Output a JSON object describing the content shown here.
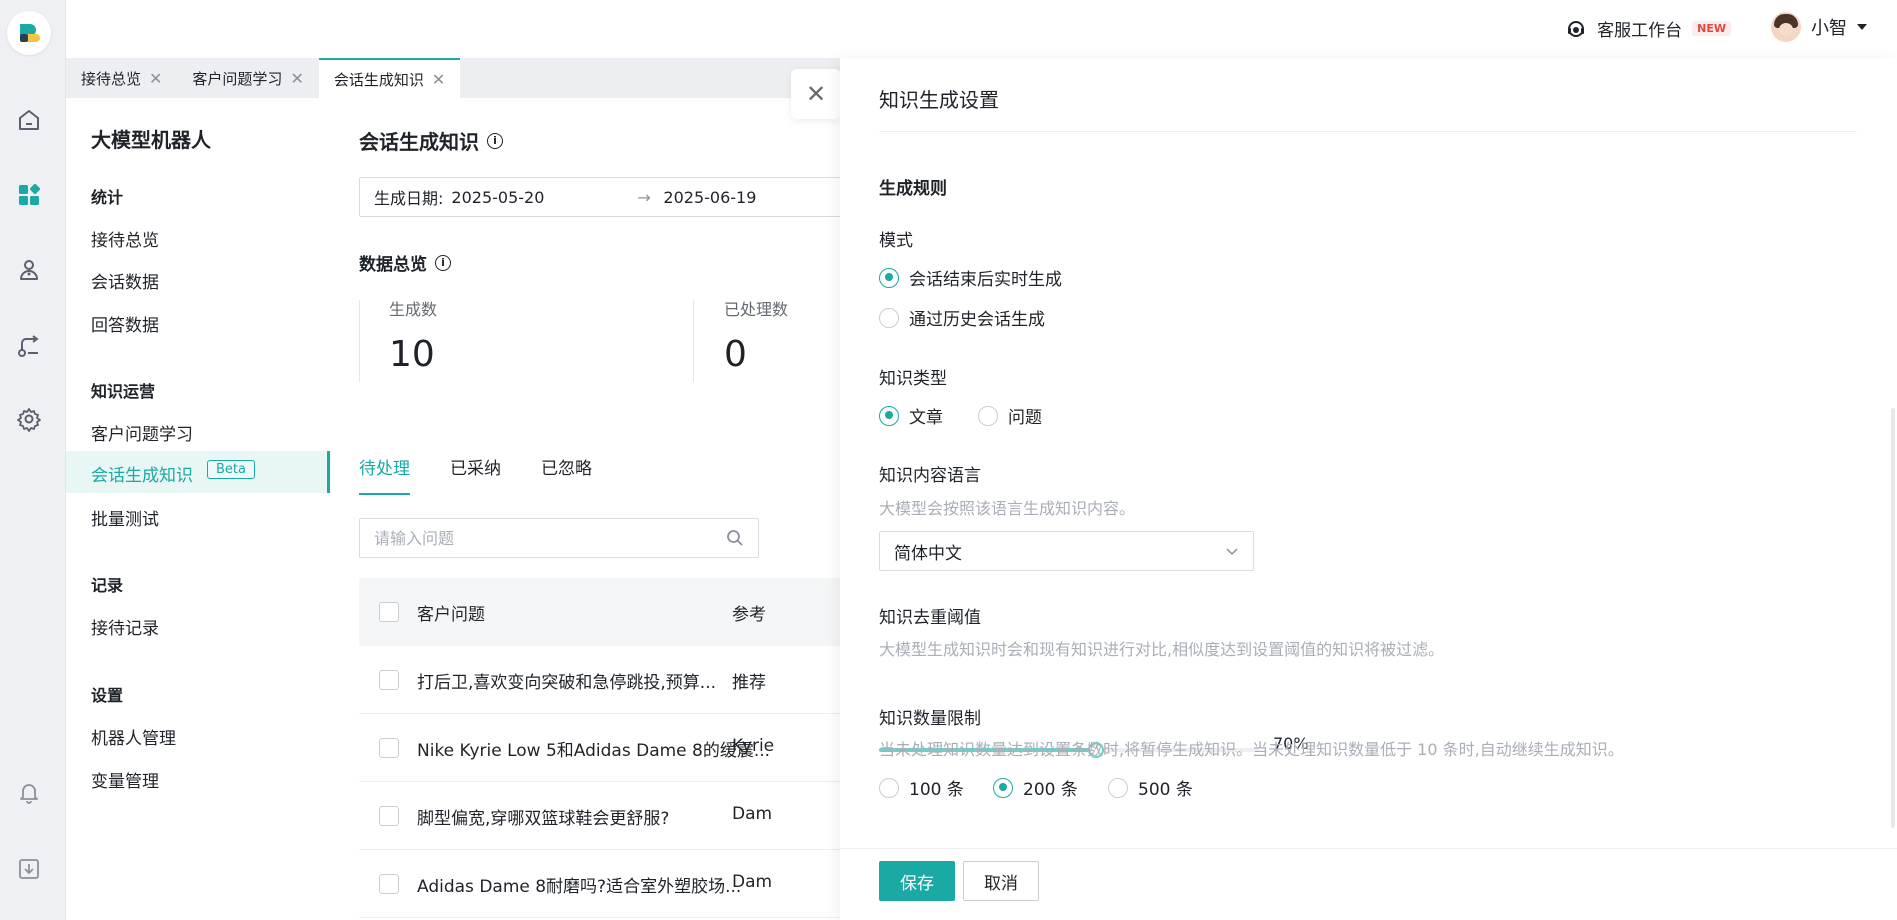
{
  "header": {
    "service_label": "客服工作台",
    "new_badge": "NEW",
    "user_name": "小智"
  },
  "tabs": [
    {
      "label": "接待总览"
    },
    {
      "label": "客户问题学习"
    },
    {
      "label": "会话生成知识"
    }
  ],
  "sidebar": {
    "title": "大模型机器人",
    "groups": {
      "stats": "统计",
      "knowledge_ops": "知识运营",
      "records": "记录",
      "settings": "设置"
    },
    "items": {
      "reception_overview": "接待总览",
      "session_data": "会话数据",
      "answer_data": "回答数据",
      "customer_question_learning": "客户问题学习",
      "session_knowledge": "会话生成知识",
      "session_knowledge_badge": "Beta",
      "batch_test": "批量测试",
      "reception_records": "接待记录",
      "bot_management": "机器人管理",
      "variable_management": "变量管理"
    }
  },
  "main": {
    "title": "会话生成知识",
    "date_label": "生成日期:",
    "date_start": "2025-05-20",
    "date_arrow": "→",
    "date_end": "2025-06-19",
    "overview_title": "数据总览",
    "stats": [
      {
        "label": "生成数",
        "value": "10"
      },
      {
        "label": "已处理数",
        "value": "0"
      }
    ],
    "list_tabs": [
      "待处理",
      "已采纳",
      "已忽略"
    ],
    "search_placeholder": "请输入问题",
    "table": {
      "headers": [
        "客户问题",
        "参考"
      ],
      "rows": [
        {
          "question": "打后卫,喜欢变向突破和急停跳投,预算...",
          "ref": "推荐"
        },
        {
          "question": "Nike Kyrie Low 5和Adidas Dame 8的缓震...",
          "ref": "Kyrie"
        },
        {
          "question": "脚型偏宽,穿哪双篮球鞋会更舒服?",
          "ref": "Dam"
        },
        {
          "question": "Adidas Dame 8耐磨吗?适合室外塑胶场...",
          "ref": "Dam"
        }
      ]
    }
  },
  "drawer": {
    "title": "知识生成设置",
    "rules_title": "生成规则",
    "mode": {
      "label": "模式",
      "options": [
        "会话结束后实时生成",
        "通过历史会话生成"
      ],
      "selected": 0
    },
    "knowledge_type": {
      "label": "知识类型",
      "options": [
        "文章",
        "问题"
      ],
      "selected": 0
    },
    "language": {
      "label": "知识内容语言",
      "hint": "大模型会按照该语言生成知识内容。",
      "value": "简体中文"
    },
    "dedup": {
      "label": "知识去重阈值",
      "hint": "大模型生成知识时会和现有知识进行对比,相似度达到设置阈值的知识将被过滤。",
      "value_percent": 70,
      "value_text": "70%"
    },
    "limit": {
      "label": "知识数量限制",
      "hint": "当未处理知识数量达到设置条数时,将暂停生成知识。当未处理知识数量低于 10 条时,自动继续生成知识。",
      "options": [
        "100 条",
        "200 条",
        "500 条"
      ],
      "selected": 1
    },
    "save_label": "保存",
    "cancel_label": "取消"
  },
  "colors": {
    "accent": "#1aa9a4",
    "accent_light": "#6fcfca",
    "new_badge": "#e8453c"
  }
}
